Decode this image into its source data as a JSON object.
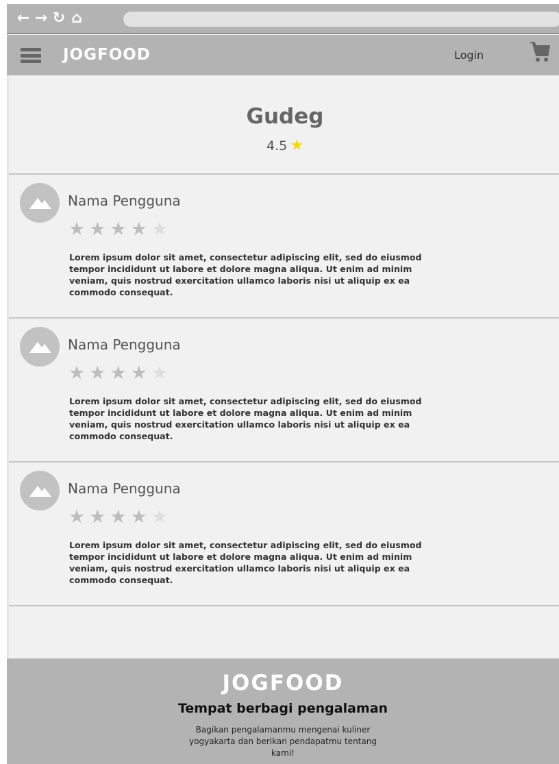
{
  "browser": {
    "icons": [
      "back-icon",
      "forward-icon",
      "reload-icon",
      "home-icon"
    ],
    "back_glyph": "←",
    "forward_glyph": "→",
    "reload_glyph": "↻",
    "home_glyph": "⌂"
  },
  "header": {
    "logo": "JOGFOOD",
    "login_label": "Login"
  },
  "hero": {
    "title": "Gudeg",
    "rating": "4.5",
    "star": "★"
  },
  "reviews": [
    {
      "name": "Nama Pengguna",
      "rating": 4,
      "max_rating": 5,
      "text": "Lorem ipsum dolor sit amet, consectetur adipiscing elit, sed do eiusmod tempor incididunt ut labore et dolore magna aliqua. Ut enim ad minim veniam, quis nostrud exercitation ullamco laboris nisi ut aliquip ex ea commodo consequat."
    },
    {
      "name": "Nama Pengguna",
      "rating": 4,
      "max_rating": 5,
      "text": "Lorem ipsum dolor sit amet, consectetur adipiscing elit, sed do eiusmod tempor incididunt ut labore et dolore magna aliqua. Ut enim ad minim veniam, quis nostrud exercitation ullamco laboris nisi ut aliquip ex ea commodo consequat."
    },
    {
      "name": "Nama Pengguna",
      "rating": 4,
      "max_rating": 5,
      "text": "Lorem ipsum dolor sit amet, consectetur adipiscing elit, sed do eiusmod tempor incididunt ut labore et dolore magna aliqua. Ut enim ad minim veniam, quis nostrud exercitation ullamco laboris nisi ut aliquip ex ea commodo consequat."
    }
  ],
  "footer": {
    "logo": "JOGFOOD",
    "title": "Tempat berbagi pengalaman",
    "description": "Bagikan pengalamanmu mengenai kuliner yogyakarta dan berikan pendapatmu tentang kami!"
  },
  "colors": {
    "chrome": "#b3b3b3",
    "panel": "#f1f1f1",
    "star_filled": "#bdbdbd",
    "star_empty": "#dedede",
    "star_gold": "#f5d90a"
  }
}
